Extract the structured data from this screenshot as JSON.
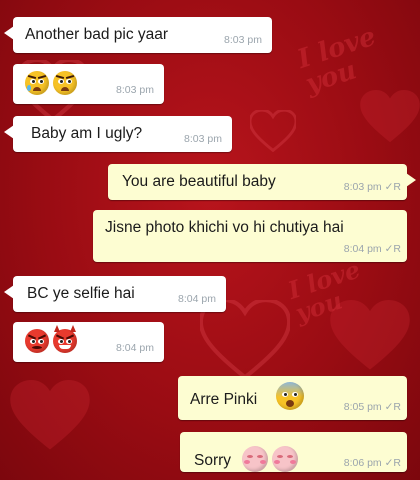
{
  "wallpaper": {
    "text_1": "I love you",
    "text_2": "I love you"
  },
  "messages": [
    {
      "direction": "incoming",
      "text": "Another bad pic yaar",
      "time": "8:03 pm"
    },
    {
      "direction": "incoming",
      "text": "",
      "emoji": [
        "worried-face-icon",
        "worried-face-icon"
      ],
      "time": "8:03 pm"
    },
    {
      "direction": "incoming",
      "text": "Baby am I ugly?",
      "time": "8:03 pm"
    },
    {
      "direction": "outgoing",
      "text": "You are beautiful baby",
      "time": "8:03 pm",
      "status": "✓R"
    },
    {
      "direction": "outgoing",
      "text": "Jisne photo khichi vo hi chutiya hai",
      "time": "8:04 pm",
      "status": "✓R"
    },
    {
      "direction": "incoming",
      "text": "BC ye selfie hai",
      "time": "8:04 pm"
    },
    {
      "direction": "incoming",
      "text": "",
      "emoji": [
        "angry-face-icon",
        "devil-face-icon"
      ],
      "time": "8:04 pm"
    },
    {
      "direction": "outgoing",
      "text": "Arre Pinki",
      "emoji": [
        "fearful-face-icon"
      ],
      "time": "8:05 pm",
      "status": "✓R"
    },
    {
      "direction": "outgoing",
      "text": "Sorry",
      "emoji": [
        "blushing-face-icon",
        "blushing-face-icon"
      ],
      "time": "8:06 pm",
      "status": "✓R"
    }
  ],
  "colors": {
    "wallpaper": "#a50f17",
    "incoming_bubble": "#ffffff",
    "outgoing_bubble": "#fdfdd2",
    "timestamp": "#9ba5ad"
  }
}
